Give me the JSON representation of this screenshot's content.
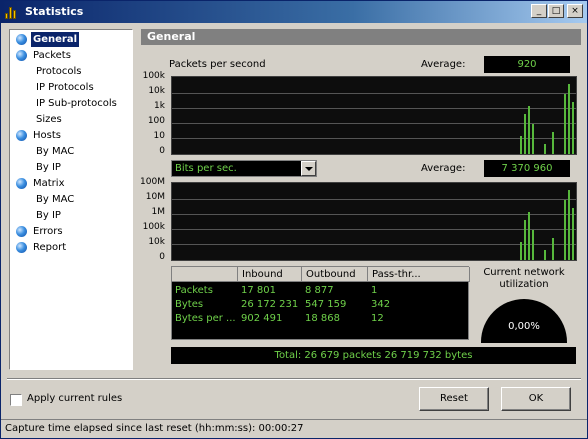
{
  "window": {
    "title": "Statistics",
    "controls": {
      "minimize": "_",
      "maximize": "□",
      "close": "×"
    }
  },
  "tree": {
    "items": [
      {
        "label": "General",
        "level": 0,
        "selected": true
      },
      {
        "label": "Packets",
        "level": 0
      },
      {
        "label": "Protocols",
        "level": 1
      },
      {
        "label": "IP Protocols",
        "level": 1
      },
      {
        "label": "IP Sub-protocols",
        "level": 1
      },
      {
        "label": "Sizes",
        "level": 1
      },
      {
        "label": "Hosts",
        "level": 0
      },
      {
        "label": "By MAC",
        "level": 1
      },
      {
        "label": "By IP",
        "level": 1
      },
      {
        "label": "Matrix",
        "level": 0
      },
      {
        "label": "By MAC",
        "level": 1
      },
      {
        "label": "By IP",
        "level": 1
      },
      {
        "label": "Errors",
        "level": 0
      },
      {
        "label": "Report",
        "level": 0
      }
    ]
  },
  "general": {
    "header": "General",
    "packets_graph": {
      "label": "Packets per second",
      "average_label": "Average:",
      "average_value": "920",
      "ticks": [
        "100k",
        "10k",
        "1k",
        "100",
        "10",
        "0"
      ]
    },
    "bits_graph": {
      "unit_selected": "Bits per sec.",
      "average_label": "Average:",
      "average_value": "7 370 960",
      "ticks": [
        "100M",
        "10M",
        "1M",
        "100k",
        "10k",
        "0"
      ]
    },
    "table": {
      "headers": [
        "",
        "Inbound",
        "Outbound",
        "Pass-thr..."
      ],
      "rows": [
        [
          "Packets",
          "17 801",
          "8 877",
          "1"
        ],
        [
          "Bytes",
          "26 172 231",
          "547 159",
          "342"
        ],
        [
          "Bytes per ...",
          "902 491",
          "18 868",
          "12"
        ]
      ]
    },
    "utilization": {
      "label": "Current network utilization",
      "value": "0,00%"
    },
    "total": "Total: 26 679 packets 26 719 732 bytes"
  },
  "footer": {
    "apply_rules_label": "Apply current rules",
    "apply_rules_checked": false,
    "reset_label": "Reset",
    "ok_label": "OK",
    "status_text": "Capture time elapsed since last reset (hh:mm:ss): 00:00:27"
  },
  "colors": {
    "accent": "#0a246a",
    "graph_bg": "#0d0d0d",
    "graph_text": "#6fd14a"
  }
}
